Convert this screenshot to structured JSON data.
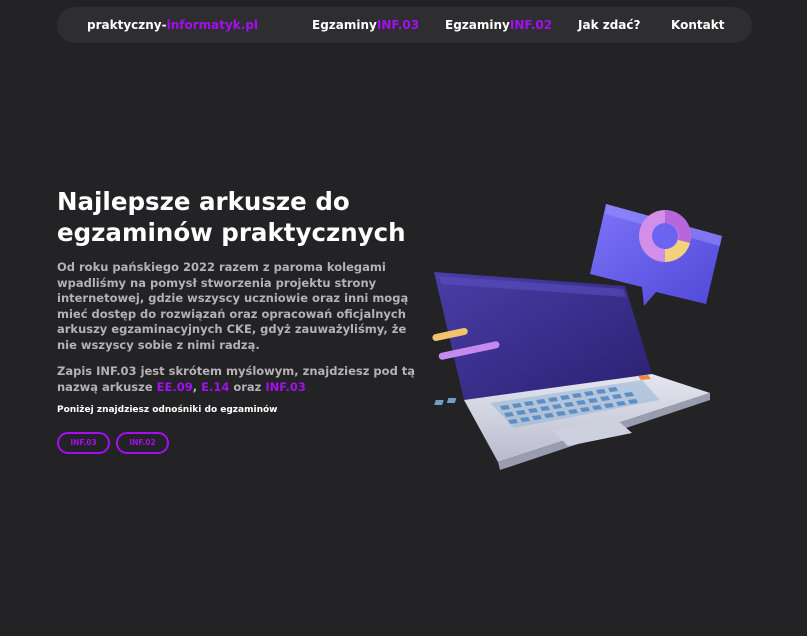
{
  "nav": {
    "logo_part1": "praktyczny-",
    "logo_part2": "informatyk.pl",
    "links": [
      {
        "label": "Egzaminy",
        "accent": "INF.03"
      },
      {
        "label": "Egzaminy",
        "accent": "INF.02"
      },
      {
        "label": "Jak zdać?"
      },
      {
        "label": "Kontakt"
      }
    ]
  },
  "hero": {
    "title_lines": [
      "Najlepsze arkusze do",
      "egzaminów praktycznych"
    ],
    "paragraph1_lines": [
      "Od roku pańskiego 2022 razem z paroma kolegami",
      "wpadliśmy na pomysł stworzenia projektu strony",
      "internetowej, gdzie wszyscy uczniowie oraz inni mogą",
      "mieć dostęp do rozwiązań oraz opracowań oficjalnych",
      "arkuszy egzaminacyjnych CKE, gdyż zauważyliśmy, że",
      "nie wszyscy sobie z nimi radzą."
    ],
    "paragraph2": {
      "line1": "Zapis INF.03 jest skrótem myślowym, znajdziesz pod tą",
      "line2_prefix": "nazwą arkusze ",
      "code1": "EE.09",
      "sep1": ", ",
      "code2": "E.14",
      "sep2": " oraz ",
      "code3": "INF.03"
    },
    "hint": "Poniżej znajdziesz odnośniki do egzaminów",
    "buttons": [
      "INF.03",
      "INF.02"
    ]
  },
  "illustration": {
    "icons": [
      "laptop-illustration",
      "chat-bubble-icon",
      "donut-chart-icon"
    ]
  },
  "colors": {
    "background": "#232224",
    "navbar": "#2e2e30",
    "accent": "#a30ff0",
    "paragraph": "#b4b2b6",
    "laptop_body": "#d7d9e6",
    "laptop_screen": "#3a2f8a",
    "bubble": "#6c63f0"
  }
}
